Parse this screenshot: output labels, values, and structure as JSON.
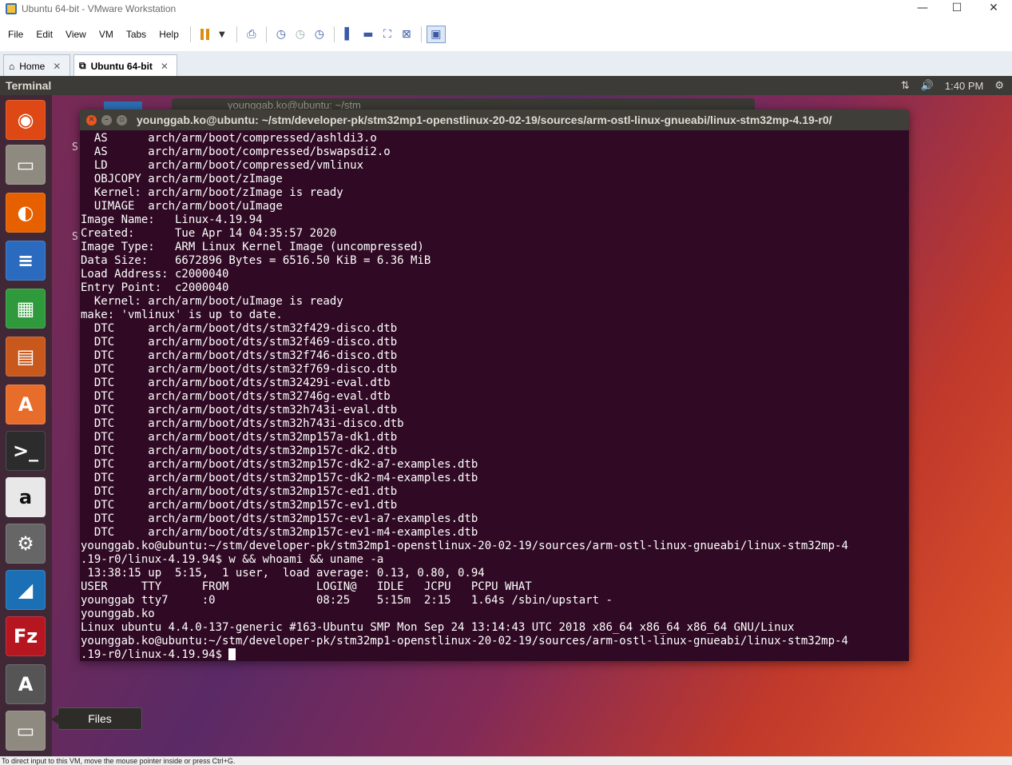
{
  "window": {
    "title": "Ubuntu 64-bit - VMware Workstation",
    "minimize": "—",
    "maximize": "☐",
    "close": "✕"
  },
  "menu": [
    "File",
    "Edit",
    "View",
    "VM",
    "Tabs",
    "Help"
  ],
  "tabs": [
    {
      "label": "Home",
      "icon": "home-icon"
    },
    {
      "label": "Ubuntu 64-bit",
      "icon": "vm-icon"
    }
  ],
  "panel": {
    "app_title": "Terminal",
    "time": "1:40 PM",
    "network_icon": "⇅",
    "volume_icon": "🔊",
    "gear_icon": "⚙"
  },
  "bg_window": {
    "title": "younggab.ko@ubuntu: ~/stm"
  },
  "side_chars": [
    "S",
    "S"
  ],
  "terminal": {
    "title": "younggab.ko@ubuntu: ~/stm/developer-pk/stm32mp1-openstlinux-20-02-19/sources/arm-ostl-linux-gnueabi/linux-stm32mp-4.19-r0/",
    "lines": [
      "  AS      arch/arm/boot/compressed/ashldi3.o",
      "  AS      arch/arm/boot/compressed/bswapsdi2.o",
      "  LD      arch/arm/boot/compressed/vmlinux",
      "  OBJCOPY arch/arm/boot/zImage",
      "  Kernel: arch/arm/boot/zImage is ready",
      "  UIMAGE  arch/arm/boot/uImage",
      "Image Name:   Linux-4.19.94",
      "Created:      Tue Apr 14 04:35:57 2020",
      "Image Type:   ARM Linux Kernel Image (uncompressed)",
      "Data Size:    6672896 Bytes = 6516.50 KiB = 6.36 MiB",
      "Load Address: c2000040",
      "Entry Point:  c2000040",
      "  Kernel: arch/arm/boot/uImage is ready",
      "make: 'vmlinux' is up to date.",
      "  DTC     arch/arm/boot/dts/stm32f429-disco.dtb",
      "  DTC     arch/arm/boot/dts/stm32f469-disco.dtb",
      "  DTC     arch/arm/boot/dts/stm32f746-disco.dtb",
      "  DTC     arch/arm/boot/dts/stm32f769-disco.dtb",
      "  DTC     arch/arm/boot/dts/stm32429i-eval.dtb",
      "  DTC     arch/arm/boot/dts/stm32746g-eval.dtb",
      "  DTC     arch/arm/boot/dts/stm32h743i-eval.dtb",
      "  DTC     arch/arm/boot/dts/stm32h743i-disco.dtb",
      "  DTC     arch/arm/boot/dts/stm32mp157a-dk1.dtb",
      "  DTC     arch/arm/boot/dts/stm32mp157c-dk2.dtb",
      "  DTC     arch/arm/boot/dts/stm32mp157c-dk2-a7-examples.dtb",
      "  DTC     arch/arm/boot/dts/stm32mp157c-dk2-m4-examples.dtb",
      "  DTC     arch/arm/boot/dts/stm32mp157c-ed1.dtb",
      "  DTC     arch/arm/boot/dts/stm32mp157c-ev1.dtb",
      "  DTC     arch/arm/boot/dts/stm32mp157c-ev1-a7-examples.dtb",
      "  DTC     arch/arm/boot/dts/stm32mp157c-ev1-m4-examples.dtb",
      "younggab.ko@ubuntu:~/stm/developer-pk/stm32mp1-openstlinux-20-02-19/sources/arm-ostl-linux-gnueabi/linux-stm32mp-4",
      ".19-r0/linux-4.19.94$ w && whoami && uname -a",
      " 13:38:15 up  5:15,  1 user,  load average: 0.13, 0.80, 0.94",
      "USER     TTY      FROM             LOGIN@   IDLE   JCPU   PCPU WHAT",
      "younggab tty7     :0               08:25    5:15m  2:15   1.64s /sbin/upstart -",
      "younggab.ko",
      "Linux ubuntu 4.4.0-137-generic #163-Ubuntu SMP Mon Sep 24 13:14:43 UTC 2018 x86_64 x86_64 x86_64 GNU/Linux",
      "younggab.ko@ubuntu:~/stm/developer-pk/stm32mp1-openstlinux-20-02-19/sources/arm-ostl-linux-gnueabi/linux-stm32mp-4"
    ],
    "prompt_tail": ".19-r0/linux-4.19.94$ "
  },
  "launcher": [
    {
      "name": "dash-icon",
      "glyph": "◉",
      "color": "#dd4814"
    },
    {
      "name": "files-icon",
      "glyph": "▭",
      "color": "#8f8a80"
    },
    {
      "name": "firefox-icon",
      "glyph": "◐",
      "color": "#e66000"
    },
    {
      "name": "writer-icon",
      "glyph": "≡",
      "color": "#2a6bbf"
    },
    {
      "name": "calc-icon",
      "glyph": "▦",
      "color": "#2f9a3c"
    },
    {
      "name": "impress-icon",
      "glyph": "▤",
      "color": "#c8581b"
    },
    {
      "name": "software-center-icon",
      "glyph": "A",
      "color": "#e86d2a"
    },
    {
      "name": "terminal-icon",
      "glyph": ">_",
      "color": "#2c2c2c"
    },
    {
      "name": "amazon-icon",
      "glyph": "a",
      "color": "#e8e8e8"
    },
    {
      "name": "system-settings-icon",
      "glyph": "⚙",
      "color": "#666666"
    },
    {
      "name": "wireshark-icon",
      "glyph": "◢",
      "color": "#1b6fb5"
    },
    {
      "name": "filezilla-icon",
      "glyph": "Fz",
      "color": "#b5161f"
    },
    {
      "name": "updater-icon",
      "glyph": "A",
      "color": "#555555"
    },
    {
      "name": "files-icon-2",
      "glyph": "▭",
      "color": "#8f8a80"
    }
  ],
  "tooltip": "Files",
  "statusbar": "To direct input to this VM, move the mouse pointer inside or press Ctrl+G."
}
